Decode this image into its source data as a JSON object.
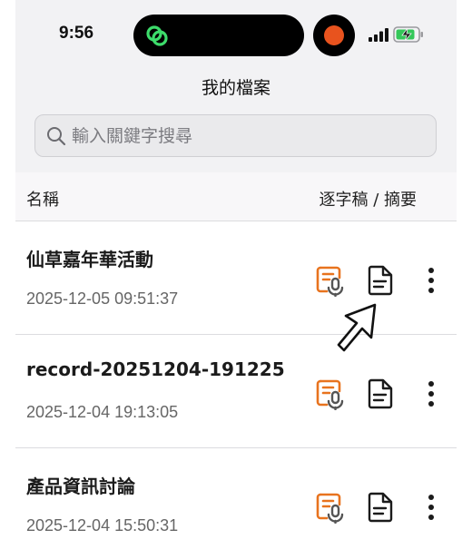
{
  "status_bar": {
    "time": "9:56"
  },
  "header": {
    "title": "我的檔案"
  },
  "search": {
    "placeholder": "輸入關鍵字搜尋"
  },
  "columns": {
    "name": "名稱",
    "actions": "逐字稿 / 摘要"
  },
  "files": [
    {
      "title": "仙草嘉年華活動",
      "date": "2025-12-05 09:51:37"
    },
    {
      "title": "record-20251204-191225",
      "date": "2025-12-04 19:13:05"
    },
    {
      "title": "產品資訊討論",
      "date": "2025-12-04 15:50:31"
    }
  ],
  "colors": {
    "transcript_icon": "#e8731e",
    "recording_dot": "#e8531e",
    "island_icon": "#3ddc6b",
    "battery_fill": "#34c759"
  }
}
